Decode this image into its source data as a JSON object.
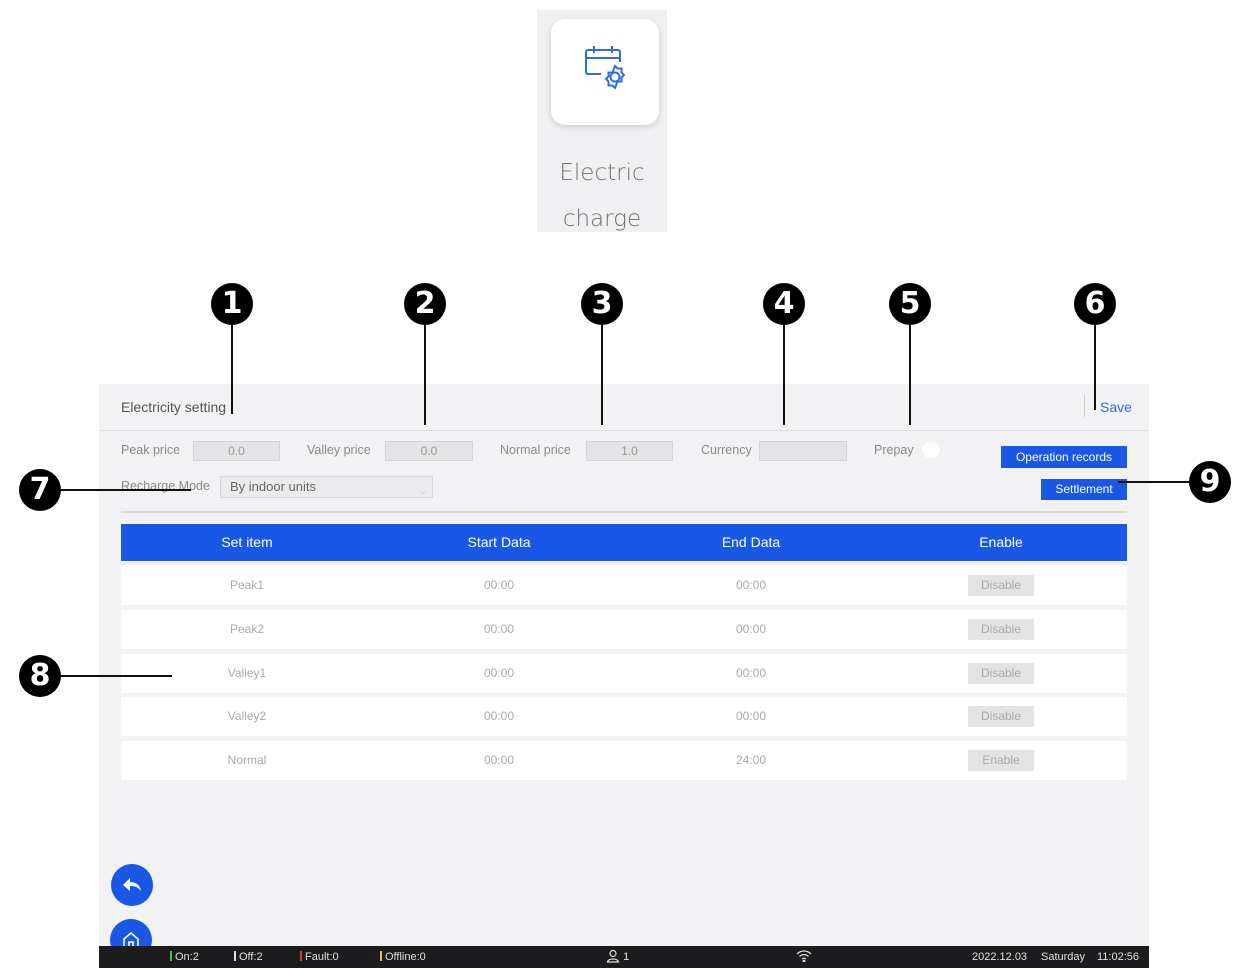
{
  "app_tile": {
    "label": "Electric\ncharge",
    "icon": "calendar-gear-icon",
    "accent": "#2d6de0"
  },
  "header": {
    "title": "Electricity setting",
    "save_label": "Save"
  },
  "prices": {
    "peak_label": "Peak price",
    "peak_value": "0.0",
    "valley_label": "Valley price",
    "valley_value": "0.0",
    "normal_label": "Normal price",
    "normal_value": "1.0",
    "currency_label": "Currency",
    "currency_value": "",
    "prepay_label": "Prepay"
  },
  "buttons": {
    "operation_records": "Operation records",
    "settlement": "Settlement"
  },
  "recharge": {
    "label": "Recharge Mode",
    "selected": "By indoor units"
  },
  "table": {
    "headers": [
      "Set item",
      "Start Data",
      "End Data",
      "Enable"
    ],
    "rows": [
      {
        "item": "Peak1",
        "start": "00:00",
        "end": "00:00",
        "enable": "Disable"
      },
      {
        "item": "Peak2",
        "start": "00:00",
        "end": "00:00",
        "enable": "Disable"
      },
      {
        "item": "Valley1",
        "start": "00:00",
        "end": "00:00",
        "enable": "Disable"
      },
      {
        "item": "Valley2",
        "start": "00:00",
        "end": "00:00",
        "enable": "Disable"
      },
      {
        "item": "Normal",
        "start": "00:00",
        "end": "24:00",
        "enable": "Enable"
      }
    ]
  },
  "status_bar": {
    "on": "On:2",
    "off": "Off:2",
    "fault": "Fault:0",
    "offline": "Offline:0",
    "users": "1",
    "date": "2022.12.03",
    "day": "Saturday",
    "time": "11:02:56",
    "colors": {
      "on": "#3cc23c",
      "off": "#dddddd",
      "fault": "#e03a3a",
      "offline": "#e0c43a"
    }
  },
  "callouts": [
    "1",
    "2",
    "3",
    "4",
    "5",
    "6",
    "7",
    "8",
    "9"
  ]
}
